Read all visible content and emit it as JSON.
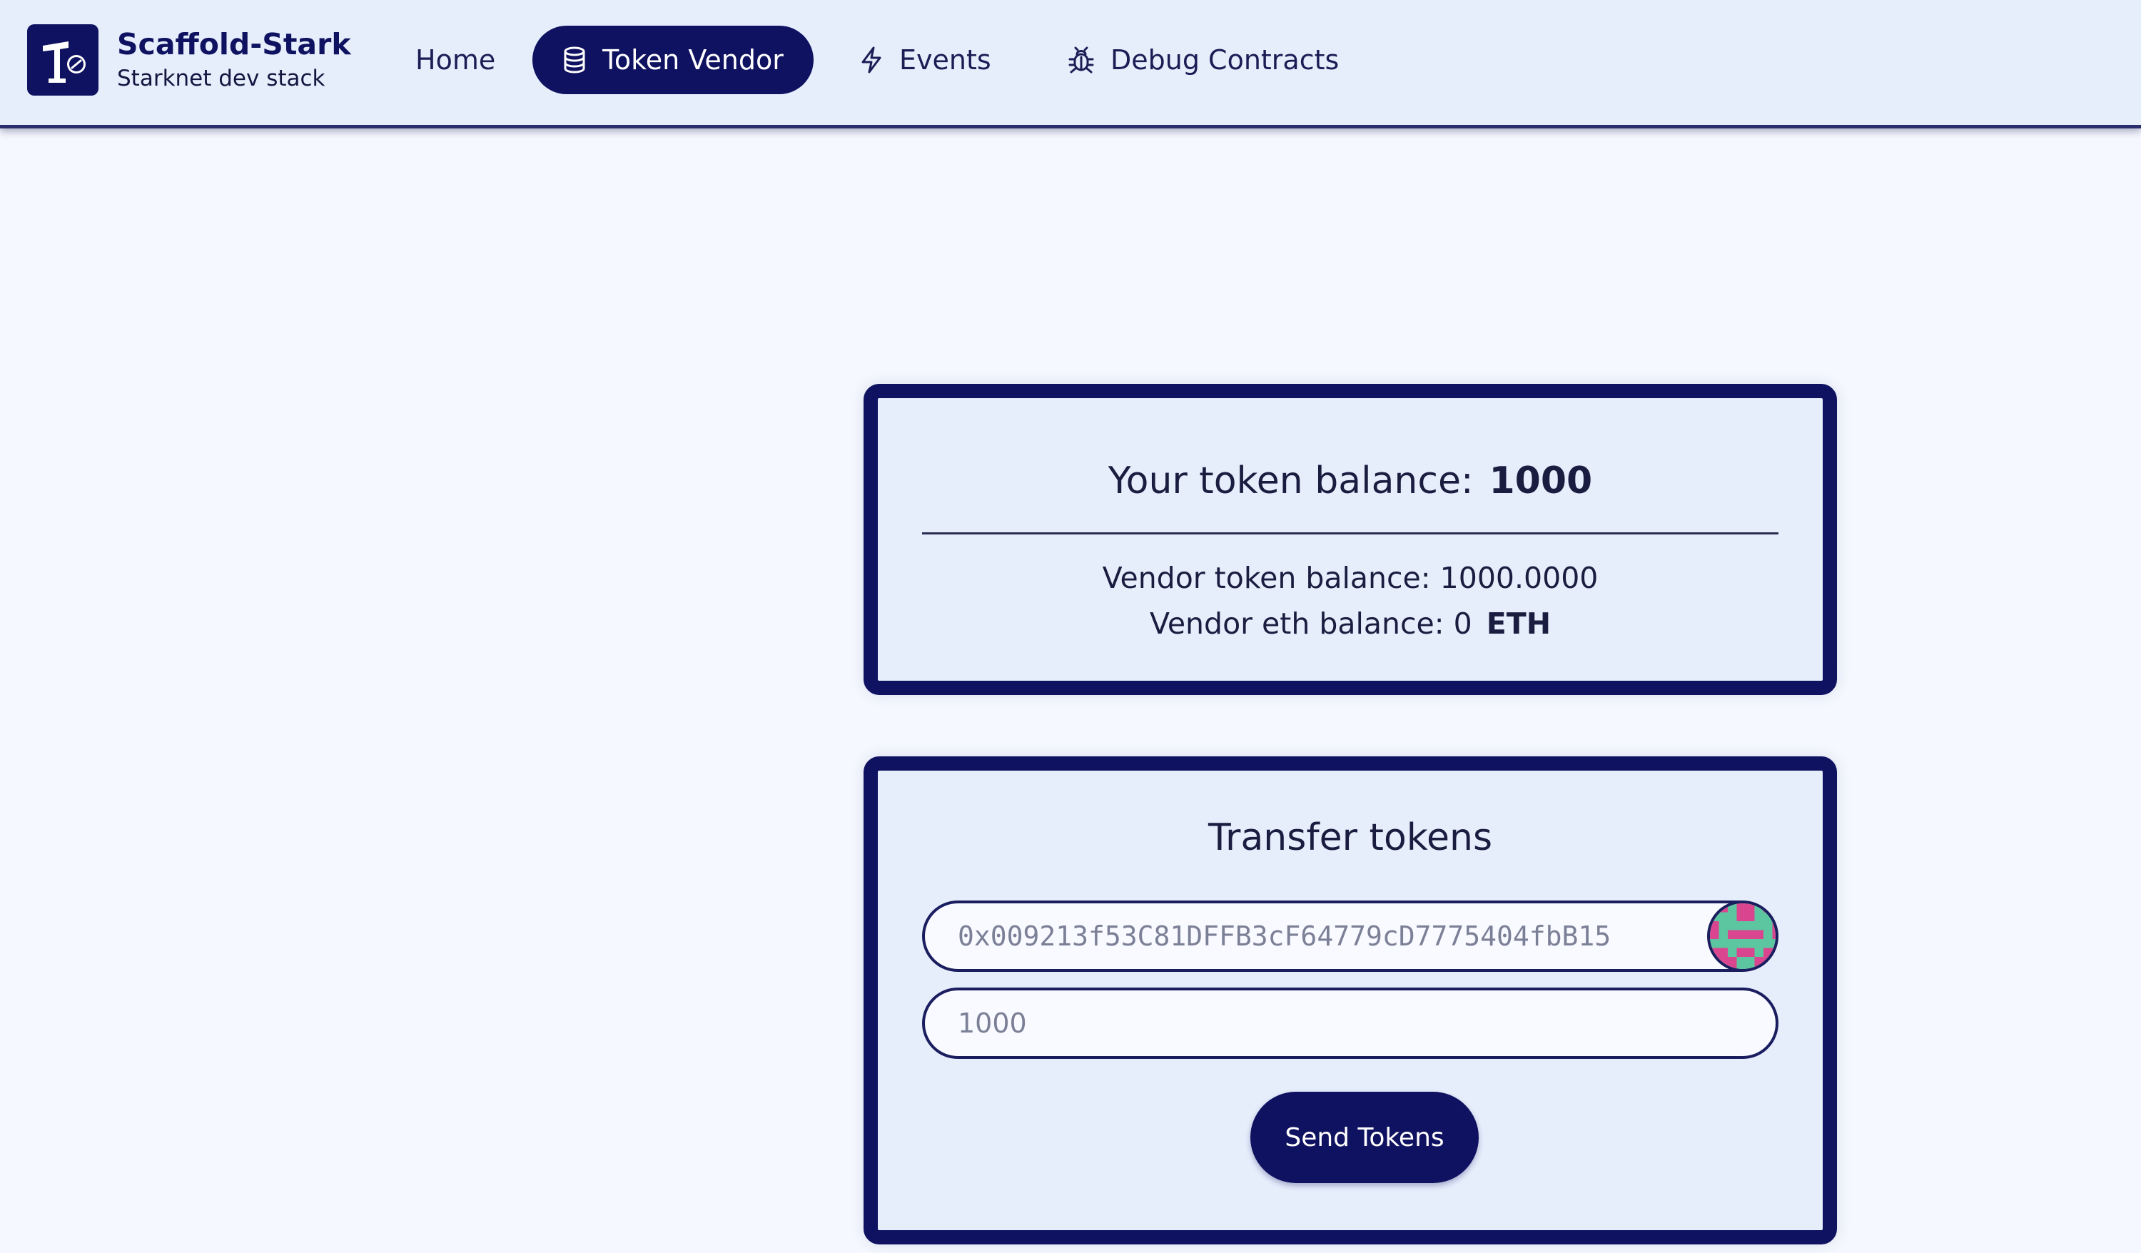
{
  "brand": {
    "title": "Scaffold-Stark",
    "subtitle": "Starknet dev stack",
    "logo_icon": "scaffold-stark-logo"
  },
  "nav": {
    "items": [
      {
        "label": "Home",
        "icon": null,
        "active": false
      },
      {
        "label": "Token Vendor",
        "icon": "database-icon",
        "active": true
      },
      {
        "label": "Events",
        "icon": "lightning-icon",
        "active": false
      },
      {
        "label": "Debug Contracts",
        "icon": "bug-icon",
        "active": false
      }
    ]
  },
  "balance_card": {
    "your_balance_label": "Your token balance:",
    "your_balance_value": "1000",
    "vendor_token_label": "Vendor token balance:",
    "vendor_token_value": "1000.0000",
    "vendor_eth_label": "Vendor eth balance:",
    "vendor_eth_value": "0",
    "vendor_eth_unit": "ETH"
  },
  "transfer_card": {
    "title": "Transfer tokens",
    "address_value": "0x009213f53C81DFFB3cF64779cD7775404fbB15",
    "amount_value": "1000",
    "send_button_label": "Send Tokens"
  },
  "colors": {
    "primary": "#0f1260",
    "card_bg": "#e6eefc",
    "page_bg": "#f5f8fe",
    "avatar_pink": "#d9468f",
    "avatar_green": "#5cc6a0"
  }
}
